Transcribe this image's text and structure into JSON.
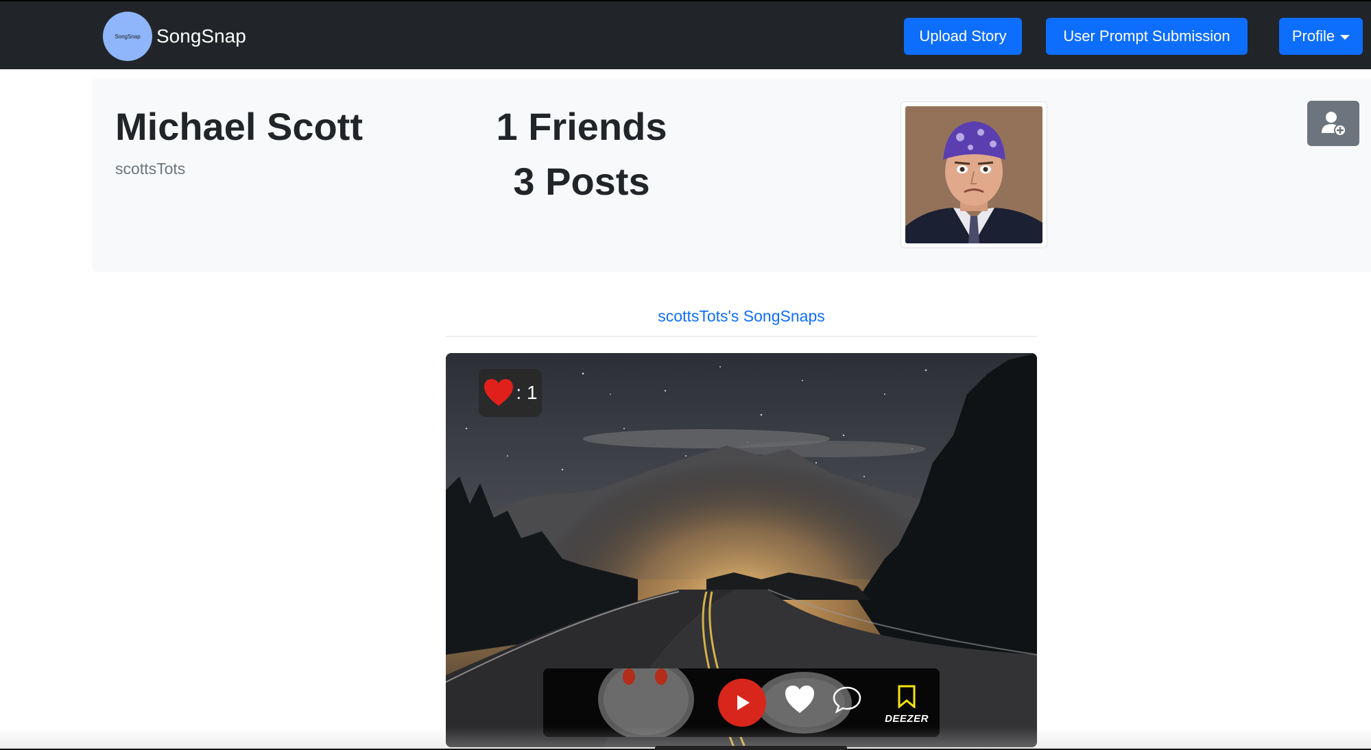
{
  "navbar": {
    "logo_text": "SongSnap",
    "brand_name": "SongSnap",
    "upload_story_label": "Upload Story",
    "prompt_submission_label": "User Prompt Submission",
    "profile_label": "Profile"
  },
  "profile": {
    "full_name": "Michael Scott",
    "username": "scottsTots",
    "friends_count": "1 Friends",
    "posts_count": "3 Posts",
    "avatar_icon": "person-photo",
    "add_friend_icon": "add-user-icon"
  },
  "songsnaps": {
    "title": "scottsTots's SongSnaps",
    "posts": [
      {
        "likes_label": ": 1",
        "player": {
          "play_icon": "play-icon",
          "like_icon": "heart-icon",
          "comment_icon": "comment-icon",
          "save_icon": "bookmark-icon",
          "provider": "DEEZER"
        }
      }
    ]
  },
  "colors": {
    "navbar_bg": "#212529",
    "primary": "#0d6efd",
    "card_bg": "#f8f9fa",
    "secondary": "#6c757d",
    "like_red": "#e0201b",
    "play_red": "#d9261c",
    "bookmark_yellow": "#f5e50a"
  }
}
